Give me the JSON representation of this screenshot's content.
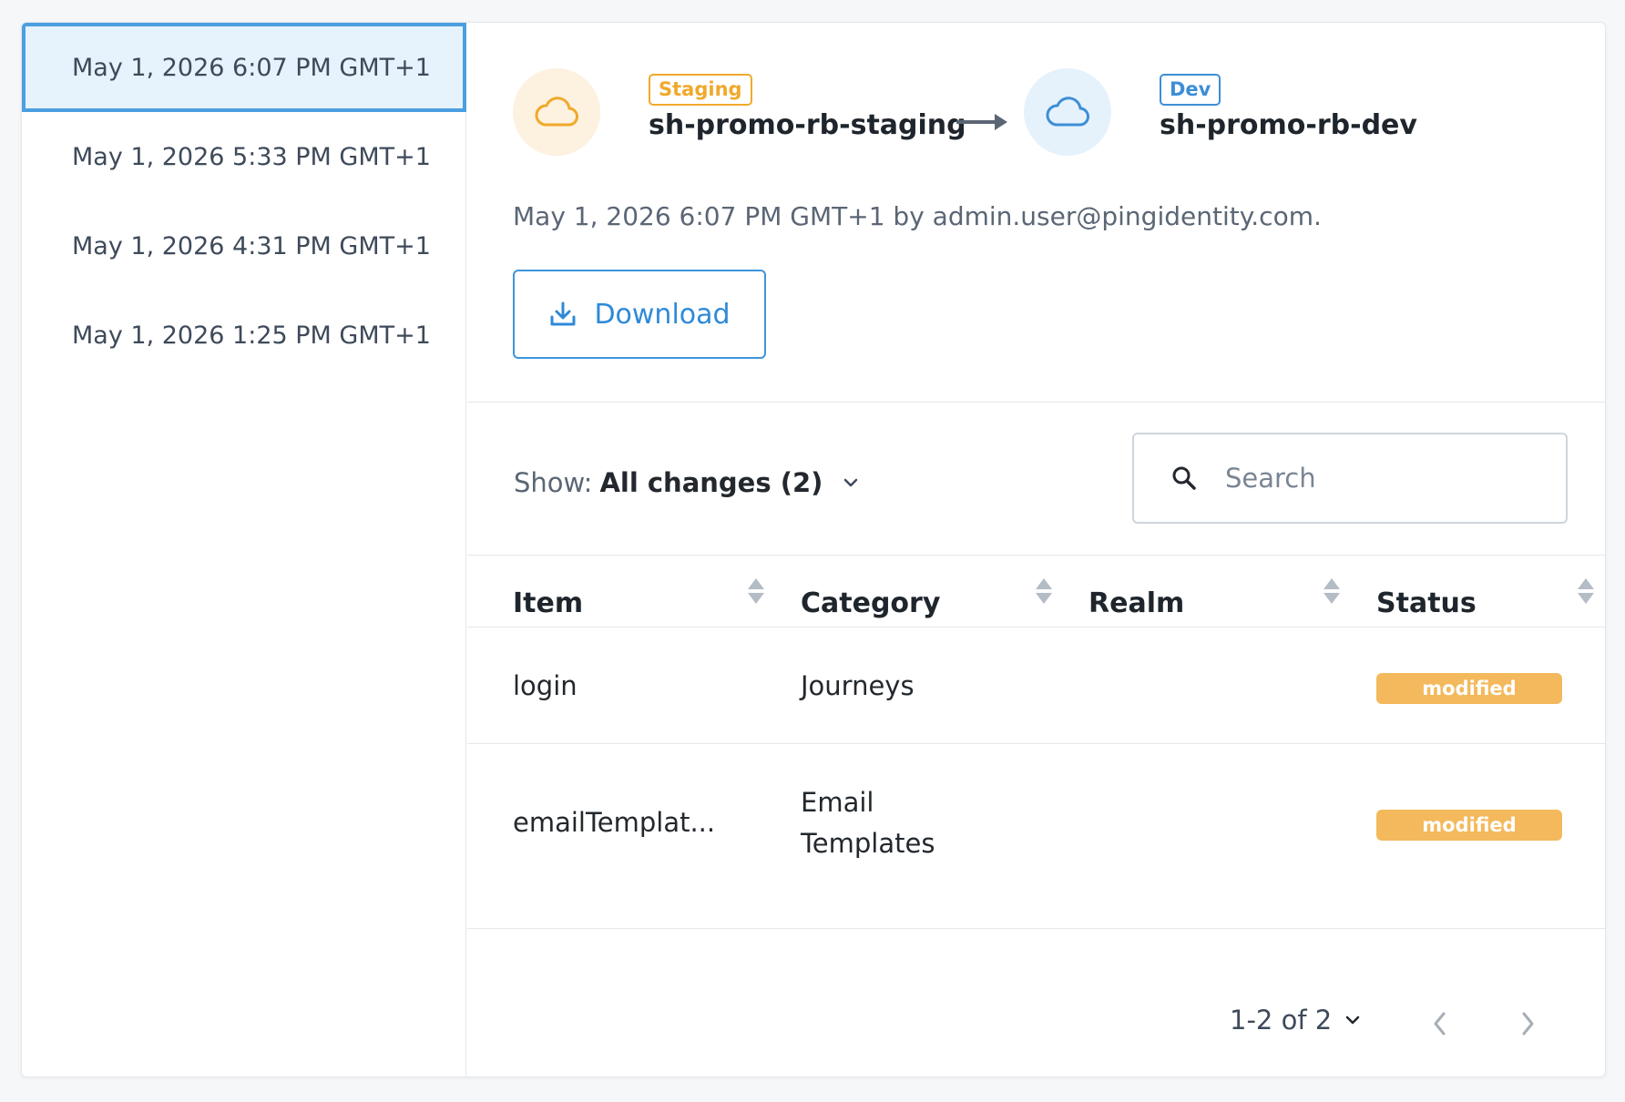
{
  "history": [
    {
      "label": "May 1, 2026 6:07 PM GMT+1",
      "active": true
    },
    {
      "label": "May 1, 2026 5:33 PM GMT+1",
      "active": false
    },
    {
      "label": "May 1, 2026 4:31 PM GMT+1",
      "active": false
    },
    {
      "label": "May 1, 2026 1:25 PM GMT+1",
      "active": false
    }
  ],
  "promotion": {
    "source": {
      "tag": "Staging",
      "name": "sh-promo-rb-staging",
      "icon": "cloud-icon",
      "color": "#f0a92b"
    },
    "target": {
      "tag": "Dev",
      "name": "sh-promo-rb-dev",
      "icon": "cloud-icon",
      "color": "#3d8ed6"
    },
    "meta": "May 1, 2026 6:07 PM GMT+1 by admin.user@pingidentity.com.",
    "download_label": "Download"
  },
  "filter": {
    "prefix": "Show:",
    "value": "All changes (2)"
  },
  "search": {
    "placeholder": "Search",
    "value": ""
  },
  "table": {
    "columns": [
      "Item",
      "Category",
      "Realm",
      "Status"
    ],
    "rows": [
      {
        "item": "login",
        "category": "Journeys",
        "realm": "",
        "status": "modified"
      },
      {
        "item": "emailTemplat...",
        "category": "Email\nTemplates",
        "realm": "",
        "status": "modified"
      }
    ]
  },
  "pagination": {
    "label": "1-2 of 2"
  },
  "colors": {
    "accent": "#3e95dc",
    "modified": "#f3b95c"
  }
}
